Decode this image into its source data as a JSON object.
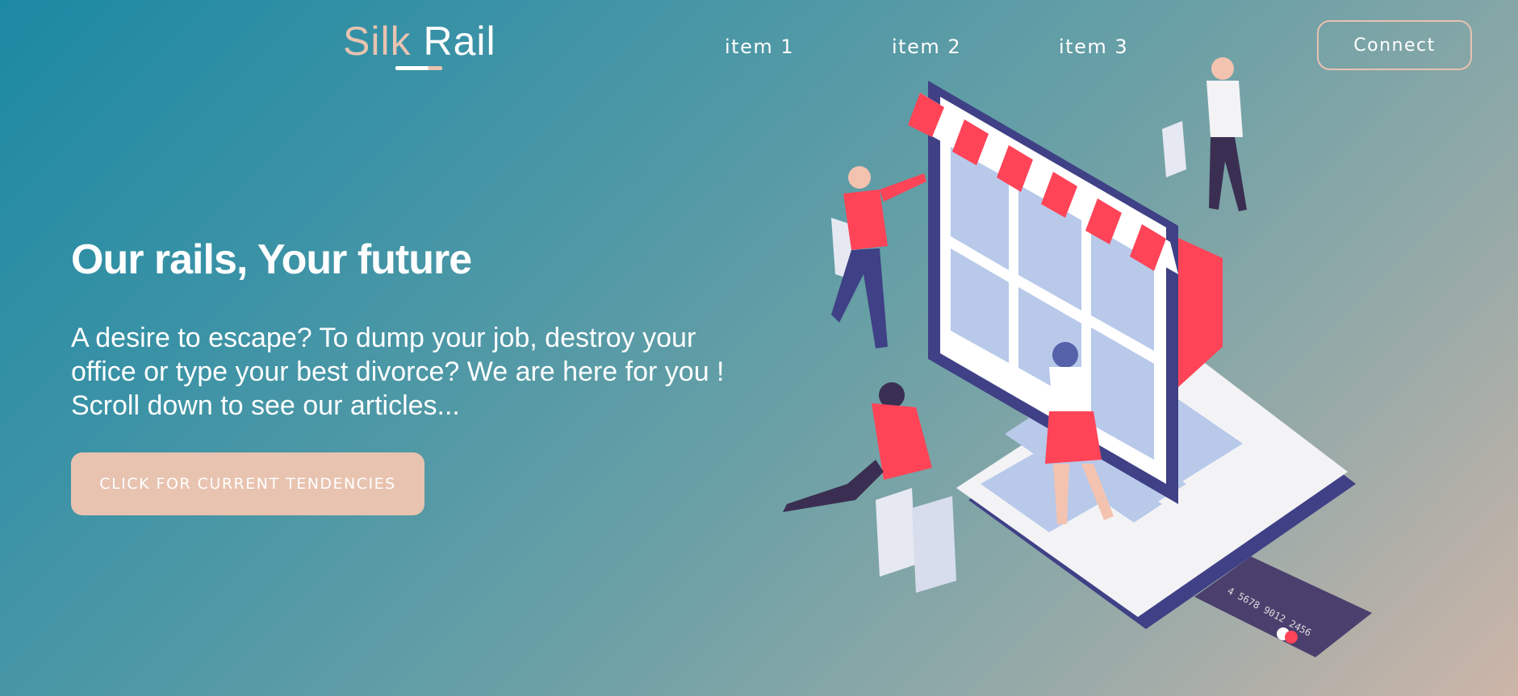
{
  "brand": {
    "word1": "Silk",
    "word2": "Rail"
  },
  "nav": {
    "items": [
      "item 1",
      "item 2",
      "item 3"
    ],
    "connect_label": "Connect"
  },
  "hero": {
    "title": "Our rails, Your future",
    "description": "A desire to escape? To dump your job, destroy your office or type your best divorce? We are here for you ! Scroll down to see our articles...",
    "cta_label": "CLICK FOR CURRENT TENDENCIES"
  },
  "illustration": {
    "card_number": "4 5678 9012 2456"
  },
  "colors": {
    "accent": "#e8c3b0",
    "laptop": "#3f4085",
    "awning_red": "#ff4458",
    "screen": "#b8c9ea"
  }
}
